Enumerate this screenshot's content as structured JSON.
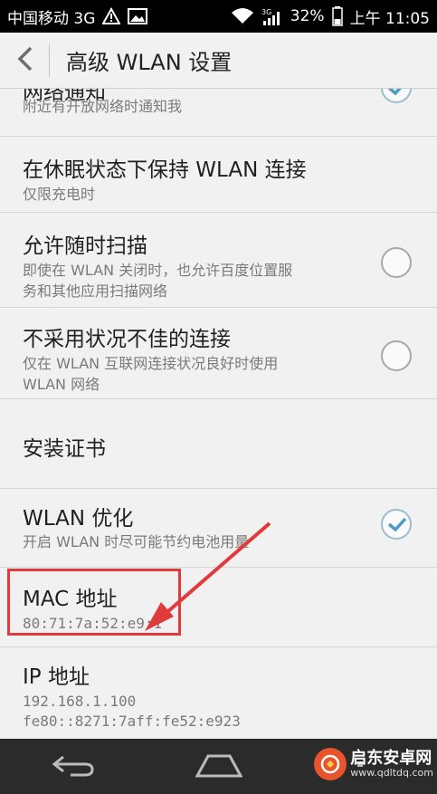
{
  "status_bar": {
    "carrier": "中国移动 3G",
    "signal_label": "3G",
    "battery": "32%",
    "time": "上午 11:05"
  },
  "header": {
    "title": "高级 WLAN 设置"
  },
  "settings": [
    {
      "title": "网络通知",
      "subtitle": "附近有开放网络时通知我",
      "toggle": true,
      "checked": true
    },
    {
      "title": "在休眠状态下保持 WLAN 连接",
      "subtitle": "仅限充电时",
      "toggle": false
    },
    {
      "title": "允许随时扫描",
      "subtitle_lines": [
        "即使在 WLAN 关闭时，也允许百度位置服",
        "务和其他应用扫描网络"
      ],
      "toggle": true,
      "checked": false
    },
    {
      "title": "不采用状况不佳的连接",
      "subtitle_lines": [
        "仅在 WLAN 互联网连接状况良好时使用",
        "WLAN 网络"
      ],
      "toggle": true,
      "checked": false
    },
    {
      "title": "安装证书"
    },
    {
      "title": "WLAN 优化",
      "subtitle": "开启 WLAN 时尽可能节约电池用量",
      "toggle": true,
      "checked": true
    },
    {
      "title": "MAC 地址",
      "subtitle": "80:71:7a:52:e9:1"
    },
    {
      "title": "IP 地址",
      "subtitle_lines": [
        "192.168.1.100",
        "fe80::8271:7aff:fe52:e923"
      ]
    }
  ],
  "watermark": {
    "name": "启东安卓网",
    "url": "www.qdltdq.com"
  },
  "colors": {
    "highlight": "#e03a3a",
    "check": "#4a9cc4"
  }
}
